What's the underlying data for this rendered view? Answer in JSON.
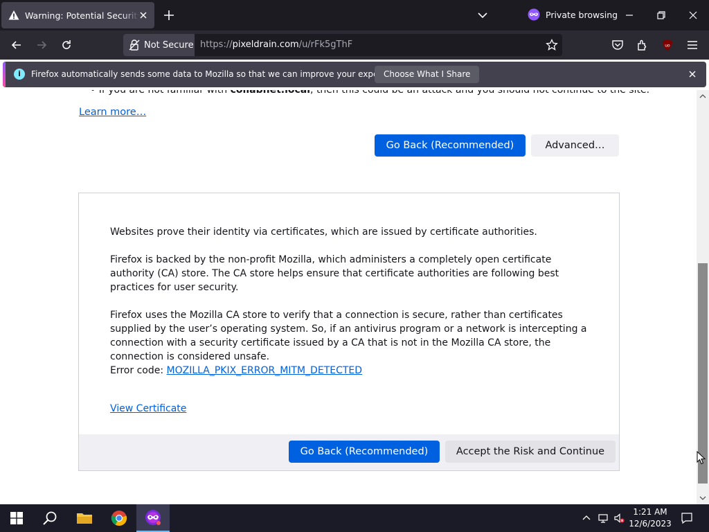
{
  "tab": {
    "title": "Warning: Potential Security Risk Ahead"
  },
  "private": {
    "label": "Private browsing"
  },
  "urlbar": {
    "security_label": "Not Secure",
    "url_prefix": "https://",
    "url_host": "pixeldrain.com",
    "url_path": "/u/rFk5gThF"
  },
  "notification": {
    "message": "Firefox automatically sends some data to Mozilla so that we can improve your experience.",
    "button": "Choose What I Share"
  },
  "page": {
    "cut_line_prefix": "If you are not familiar with ",
    "cut_line_bold": "collabnet.local",
    "cut_line_suffix": ", then this could be an attack and you should not continue to the site.",
    "learn_more": "Learn more…",
    "go_back": "Go Back (Recommended)",
    "advanced": "Advanced…"
  },
  "advanced_panel": {
    "p1": "Websites prove their identity via certificates, which are issued by certificate authorities.",
    "p2": "Firefox is backed by the non-profit Mozilla, which administers a completely open certificate authority (CA) store. The CA store helps ensure that certificate authorities are following best practices for user security.",
    "p3": "Firefox uses the Mozilla CA store to verify that a connection is secure, rather than certificates supplied by the user’s operating system. So, if an antivirus program or a network is intercepting a connection with a security certificate issued by a CA that is not in the Mozilla CA store, the connection is considered unsafe.",
    "error_label": "Error code: ",
    "error_code": "MOZILLA_PKIX_ERROR_MITM_DETECTED",
    "view_certificate": "View Certificate",
    "go_back": "Go Back (Recommended)",
    "accept": "Accept the Risk and Continue"
  },
  "taskbar": {
    "time": "1:21 AM",
    "date": "12/6/2023",
    "apps": [
      "start-icon",
      "search-icon",
      "file-explorer-icon",
      "chrome-icon",
      "firefox-private-icon"
    ]
  },
  "colors": {
    "accent_blue": "#0061e0",
    "chrome_dark": "#1c1b22",
    "toolbar": "#2b2a33",
    "tab_active": "#42414d"
  }
}
